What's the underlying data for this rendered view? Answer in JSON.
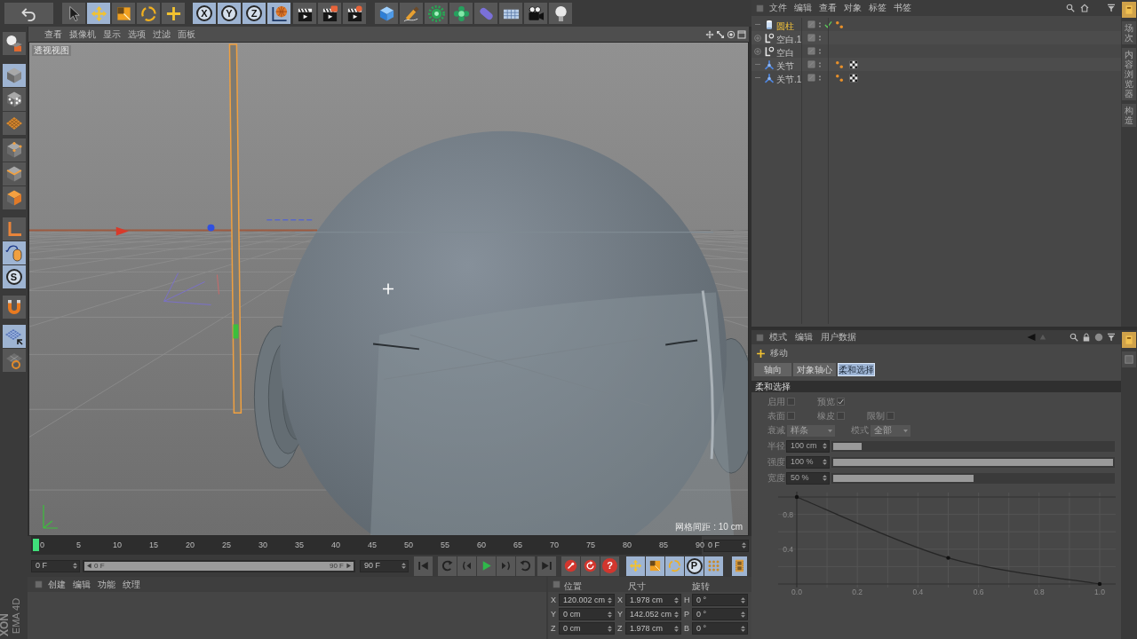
{
  "toolbar": {
    "groups": [
      {
        "items": [
          {
            "kind": "icon",
            "selected": false
          }
        ]
      },
      {
        "items": [
          {
            "kind": "icon",
            "selected": false
          },
          {
            "kind": "icon",
            "selected": true
          },
          {
            "kind": "icon",
            "selected": false
          },
          {
            "kind": "icon",
            "selected": false
          },
          {
            "kind": "icon",
            "selected": false
          }
        ]
      },
      {
        "items": [
          {
            "kind": "letter",
            "label": "X",
            "selected": true
          },
          {
            "kind": "letter",
            "label": "Y",
            "selected": true
          },
          {
            "kind": "letter",
            "label": "Z",
            "selected": true
          },
          {
            "kind": "icon",
            "selected": true
          }
        ]
      },
      {
        "items": [
          {
            "kind": "icon",
            "selected": false
          },
          {
            "kind": "icon",
            "selected": false
          },
          {
            "kind": "icon",
            "selected": false
          }
        ]
      },
      {
        "items": [
          {
            "kind": "icon",
            "selected": false
          },
          {
            "kind": "icon",
            "selected": false
          },
          {
            "kind": "icon",
            "selected": false
          },
          {
            "kind": "icon",
            "selected": false
          },
          {
            "kind": "icon",
            "selected": false
          },
          {
            "kind": "icon",
            "selected": false
          },
          {
            "kind": "icon",
            "selected": false
          },
          {
            "kind": "icon",
            "selected": false
          }
        ]
      }
    ]
  },
  "left_toolbar": {
    "groups": [
      {
        "items": [
          {
            "kind": "icon",
            "selected": false
          }
        ]
      },
      {
        "items": [
          {
            "kind": "icon",
            "selected": true
          },
          {
            "kind": "icon",
            "selected": false
          },
          {
            "kind": "icon",
            "selected": false
          }
        ]
      },
      {
        "items": [
          {
            "kind": "icon",
            "selected": false
          },
          {
            "kind": "icon",
            "selected": false
          },
          {
            "kind": "icon",
            "selected": false
          }
        ]
      },
      {
        "items": [
          {
            "kind": "icon",
            "selected": false
          }
        ]
      },
      {
        "items": [
          {
            "kind": "icon",
            "selected": true
          },
          {
            "kind": "letter",
            "label": "S",
            "selected": true
          }
        ]
      },
      {
        "items": [
          {
            "kind": "icon",
            "selected": false
          }
        ]
      },
      {
        "items": [
          {
            "kind": "icon",
            "selected": true
          },
          {
            "kind": "icon",
            "selected": false
          }
        ]
      }
    ]
  },
  "viewport": {
    "menu": [
      "查看",
      "摄像机",
      "显示",
      "选项",
      "过滤",
      "面板"
    ],
    "view_name": "透视视图",
    "grid_spacing": "网格间距 : 10 cm"
  },
  "timeline": {
    "ticks": [
      "0",
      "5",
      "10",
      "15",
      "20",
      "25",
      "30",
      "35",
      "40",
      "45",
      "50",
      "55",
      "60",
      "65",
      "70",
      "75",
      "80",
      "85",
      "90"
    ],
    "playhead": {
      "level": 0
    },
    "current_frame": "0 F"
  },
  "range": {
    "start": "0 F",
    "slider_start": "0 F",
    "slider_end": "90 F",
    "level": 1,
    "end": "90 F"
  },
  "playback": {
    "groups": [
      {
        "items": [
          {
            "kind": "icon",
            "selected": false
          }
        ]
      },
      {
        "items": [
          {
            "kind": "icon",
            "selected": false
          },
          {
            "kind": "icon",
            "selected": false
          },
          {
            "kind": "icon",
            "selected": false
          },
          {
            "kind": "icon",
            "selected": false
          },
          {
            "kind": "icon",
            "selected": false
          }
        ]
      },
      {
        "items": [
          {
            "kind": "icon",
            "selected": false
          }
        ]
      },
      {
        "items": [
          {
            "kind": "icon",
            "selected": false
          },
          {
            "kind": "icon",
            "selected": false
          },
          {
            "kind": "letter",
            "label": "?",
            "selected": false
          }
        ]
      },
      {
        "items": [
          {
            "kind": "icon",
            "selected": true
          },
          {
            "kind": "icon",
            "selected": true
          },
          {
            "kind": "icon",
            "selected": true
          },
          {
            "kind": "letter",
            "label": "P",
            "selected": true
          },
          {
            "kind": "icon",
            "selected": true
          }
        ]
      },
      {
        "items": [
          {
            "kind": "icon",
            "selected": true
          }
        ]
      }
    ]
  },
  "material_manager": {
    "menu": [
      "创建",
      "编辑",
      "功能",
      "纹理"
    ]
  },
  "coordinates": {
    "headers": [
      "位置",
      "尺寸",
      "旋转"
    ],
    "rows": [
      {
        "cells": [
          {
            "axis": "X",
            "value": "120.002 cm"
          },
          {
            "axis": "X",
            "value": "1.978 cm"
          },
          {
            "axis": "H",
            "value": "0 °"
          }
        ]
      },
      {
        "cells": [
          {
            "axis": "Y",
            "value": "0 cm"
          },
          {
            "axis": "Y",
            "value": "142.052 cm"
          },
          {
            "axis": "P",
            "value": "0 °"
          }
        ]
      },
      {
        "cells": [
          {
            "axis": "Z",
            "value": "0 cm"
          },
          {
            "axis": "Z",
            "value": "1.978 cm"
          },
          {
            "axis": "B",
            "value": "0 °"
          }
        ]
      }
    ]
  },
  "logo": [
    "XON",
    "EMA 4D"
  ],
  "object_manager": {
    "menu": [
      "文件",
      "编辑",
      "查看",
      "对象",
      "标签",
      "书签"
    ],
    "objects": [
      {
        "kind": "cylinder",
        "name": "圆柱",
        "selected": true,
        "enabled": true,
        "tags": [
          {
            "kind": "dots"
          }
        ]
      },
      {
        "kind": "null",
        "name": "空白.1",
        "selected": false,
        "expanded": false
      },
      {
        "kind": "null",
        "name": "空白",
        "selected": false,
        "expanded": false
      },
      {
        "kind": "joint",
        "name": "关节",
        "selected": false,
        "tags": [
          {
            "kind": "dots"
          },
          {
            "kind": "checker"
          }
        ]
      },
      {
        "kind": "joint",
        "name": "关节.1",
        "selected": false,
        "tags": [
          {
            "kind": "dots"
          },
          {
            "kind": "checker"
          }
        ]
      }
    ],
    "side_tabs": [
      {
        "kind": "icon",
        "selected": true
      },
      {
        "kind": "text",
        "label": "场次",
        "selected": false
      },
      {
        "kind": "text",
        "label": "内容浏览器",
        "selected": false
      },
      {
        "kind": "text",
        "label": "构造",
        "selected": false
      }
    ]
  },
  "attribute_manager": {
    "menu": [
      "模式",
      "编辑",
      "用户数据"
    ],
    "tool": "移动",
    "tabs": [
      {
        "label": "轴向",
        "selected": false
      },
      {
        "label": "对象轴心",
        "selected": false
      },
      {
        "label": "柔和选择",
        "selected": true
      }
    ],
    "section": "柔和选择",
    "disabled": true,
    "options": [
      [
        {
          "label": "启用",
          "checked": false
        },
        {
          "label": "预览",
          "checked": true
        }
      ],
      [
        {
          "label": "表面",
          "checked": false
        },
        {
          "label": "橡皮",
          "checked": false
        },
        {
          "label": "限制",
          "checked": false
        }
      ]
    ],
    "dropdowns": [
      {
        "label": "衰减",
        "value": "样条"
      },
      {
        "label": "模式",
        "value": "全部"
      }
    ],
    "sliders": [
      {
        "label": "半径",
        "value": "100 cm",
        "level": 0.1
      },
      {
        "label": "强度",
        "value": "100 %",
        "level": 1
      },
      {
        "label": "宽度",
        "value": "50 %",
        "level": 0.5
      }
    ],
    "side_tabs": [
      {
        "kind": "icon",
        "selected": true
      },
      {
        "kind": "icon",
        "selected": false
      }
    ],
    "chart_data": [
      {
        "type": "line",
        "x": [
          0,
          0.5,
          1
        ],
        "values": [
          1,
          0.3,
          0
        ],
        "grid": true,
        "xlim": [
          0,
          1
        ],
        "ylim": [
          0,
          1
        ],
        "xticks": [
          {
            "value": 0,
            "label": "0.0"
          },
          {
            "value": 0.2,
            "label": "0.2"
          },
          {
            "value": 0.4,
            "label": "0.4"
          },
          {
            "value": 0.6,
            "label": "0.6"
          },
          {
            "value": 0.8,
            "label": "0.8"
          },
          {
            "value": 1,
            "label": "1.0"
          }
        ],
        "yticks": [
          {
            "value": 0.4,
            "label": "0.4"
          },
          {
            "value": 0.8,
            "label": "0.8"
          }
        ]
      }
    ]
  }
}
